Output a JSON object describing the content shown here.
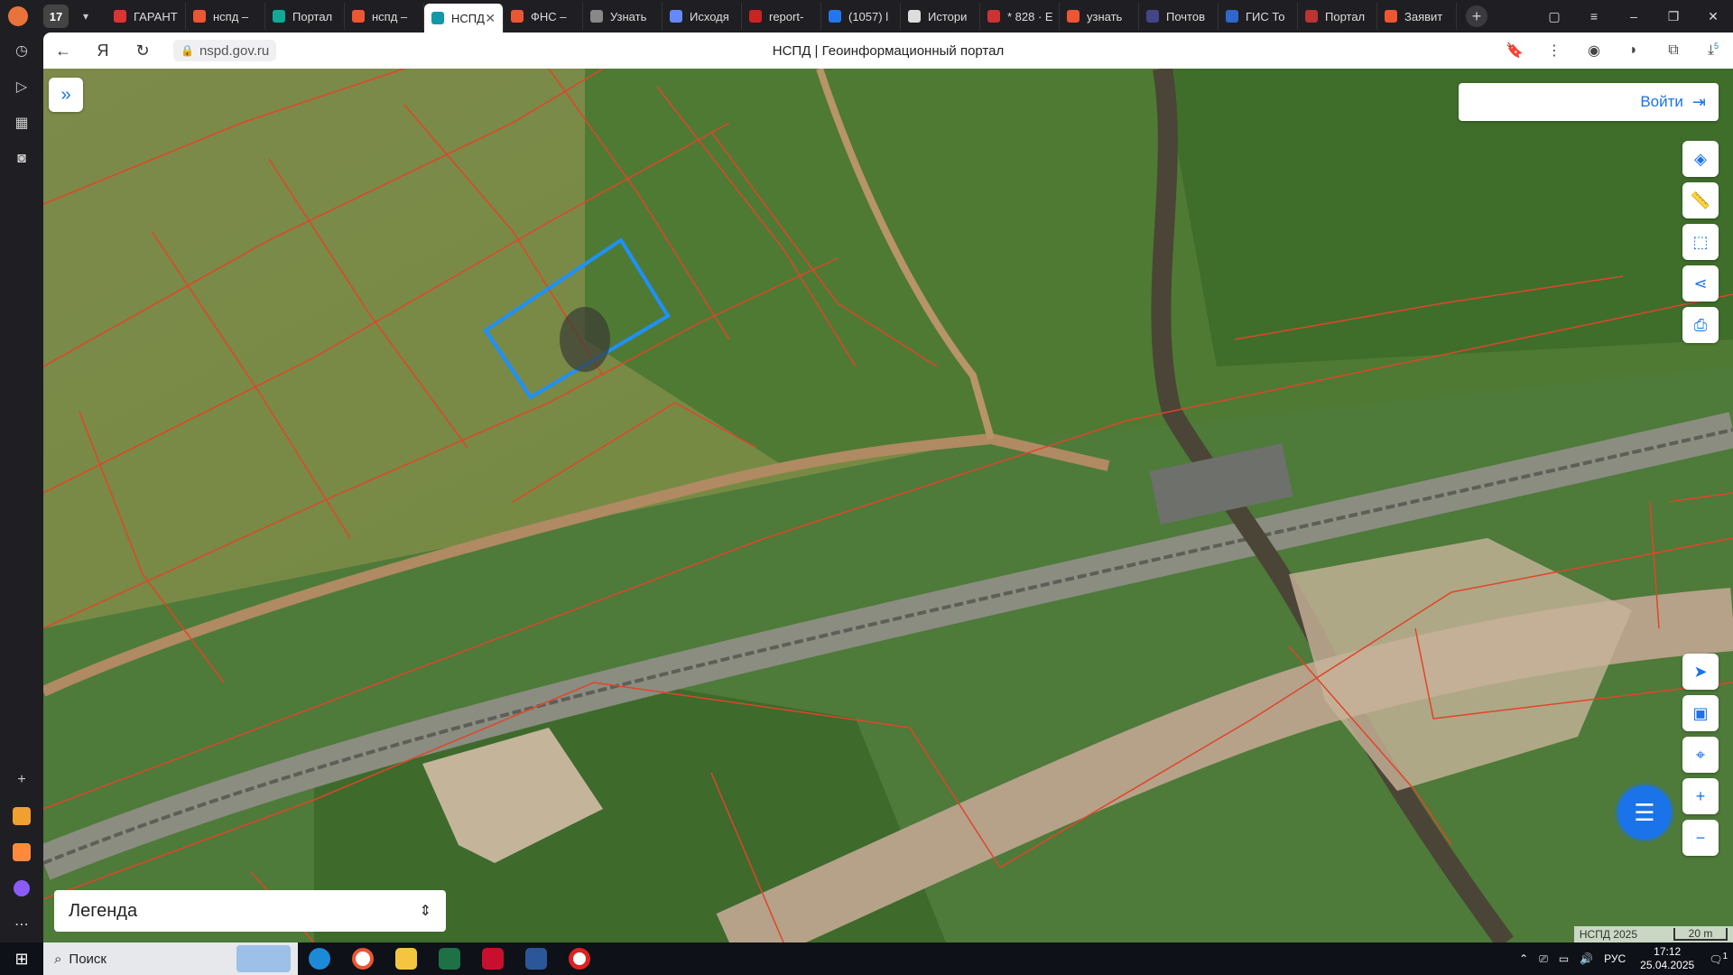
{
  "browser": {
    "tab_count": "17",
    "tabs": [
      {
        "label": "ГАРАНТ",
        "color": "#d33"
      },
      {
        "label": "нспд –",
        "color": "#e53"
      },
      {
        "label": "Портал",
        "color": "#1a9"
      },
      {
        "label": "нспд –",
        "color": "#e53"
      },
      {
        "label": "НСПД",
        "color": "#19a",
        "active": true
      },
      {
        "label": "ФНС –",
        "color": "#e53"
      },
      {
        "label": "Узнать",
        "color": "#888"
      },
      {
        "label": "Исходя",
        "color": "#68f"
      },
      {
        "label": "report-",
        "color": "#c22"
      },
      {
        "label": "(1057) l",
        "color": "#27e"
      },
      {
        "label": "Истори",
        "color": "#ddd"
      },
      {
        "label": "* 828 · E",
        "color": "#c33"
      },
      {
        "label": "узнать",
        "color": "#e53"
      },
      {
        "label": "Почтов",
        "color": "#448"
      },
      {
        "label": "ГИС То",
        "color": "#36c"
      },
      {
        "label": "Портал",
        "color": "#b33"
      },
      {
        "label": "Заявит",
        "color": "#e53"
      }
    ],
    "url": "nspd.gov.ru",
    "page_title": "НСПД | Геоинформационный портал",
    "downloads_badge": "5"
  },
  "map": {
    "login_label": "Войти",
    "legend_label": "Легенда",
    "attribution": "НСПД 2025",
    "scale_label": "20 m"
  },
  "taskbar": {
    "search_placeholder": "Поиск",
    "language": "РУС",
    "time": "17:12",
    "date": "25.04.2025",
    "notifications": "1"
  },
  "colors": {
    "accent": "#1a73e8",
    "parcel_border": "#e0452a",
    "selected_parcel": "#1e90ff"
  }
}
